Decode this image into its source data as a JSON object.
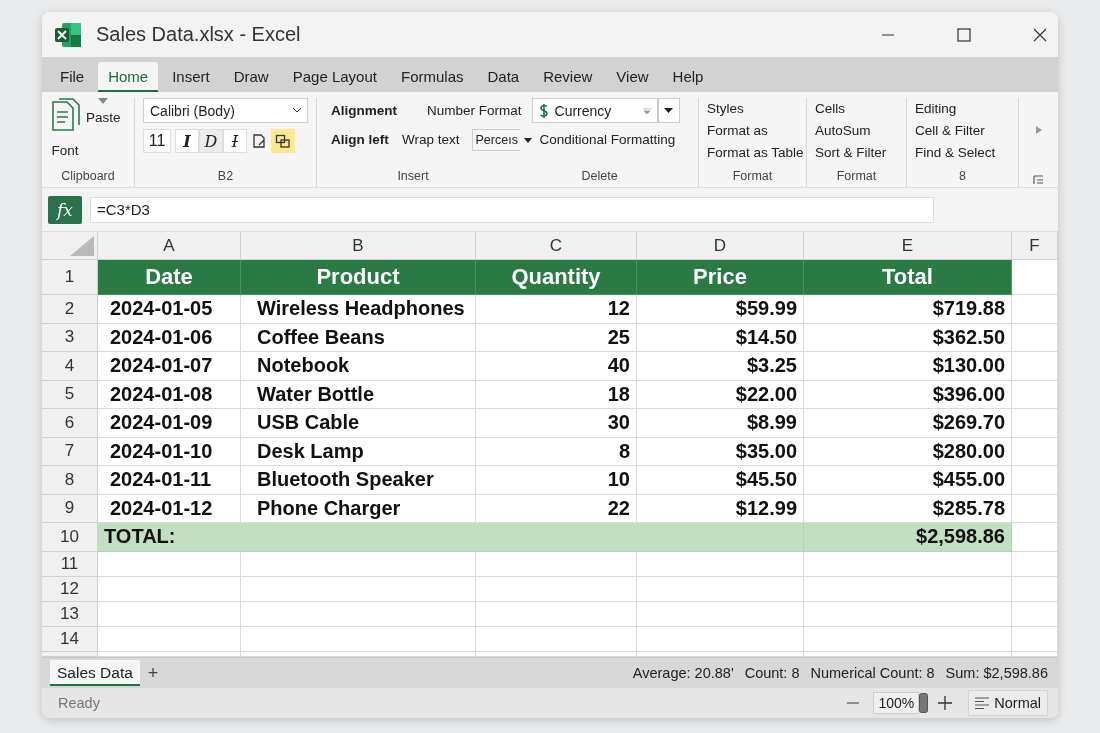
{
  "window": {
    "title": "Sales Data.xlsx - Excel"
  },
  "menu_tabs": [
    {
      "label": "File",
      "selected": false
    },
    {
      "label": "Home",
      "selected": true
    },
    {
      "label": "Insert",
      "selected": false
    },
    {
      "label": "Draw",
      "selected": false
    },
    {
      "label": "Page Layout",
      "selected": false
    },
    {
      "label": "Formulas",
      "selected": false
    },
    {
      "label": "Data",
      "selected": false
    },
    {
      "label": "Review",
      "selected": false
    },
    {
      "label": "View",
      "selected": false
    },
    {
      "label": "Help",
      "selected": false
    }
  ],
  "ribbon": {
    "clipboard": {
      "paste": "Paste",
      "font": "Font",
      "label": "Clipboard"
    },
    "font": {
      "name": "Calibri (Body)",
      "size": "11",
      "label": "B2",
      "style_buttons": [
        {
          "kind": "italic",
          "label": "I",
          "selected": false
        },
        {
          "kind": "plain",
          "label": "D",
          "selected": true
        },
        {
          "kind": "strike",
          "label": "I",
          "selected": false
        },
        {
          "kind": "clear",
          "selected": false
        },
        {
          "kind": "copy",
          "selected": true
        }
      ]
    },
    "alignment": {
      "alignment": "Alignment",
      "align_left": "Align left",
      "wrap_text": "Wrap text",
      "number_format_label": "Number Format",
      "number_format": "Currency",
      "percent_field": "Perceıs",
      "conditional_formatting": "Conditional Formatting",
      "labels": [
        "Insert",
        "Delete"
      ]
    },
    "groups": [
      {
        "items": [
          "Styles",
          "Format as",
          "Format as Table"
        ],
        "label": "Format"
      },
      {
        "items": [
          "Cells",
          "AutoSum",
          "Sort & Filter"
        ],
        "label": "Format"
      },
      {
        "items": [
          "Editing",
          "Cell & Filter",
          "Find & Select"
        ],
        "label": "8"
      }
    ]
  },
  "formula_bar": {
    "fx": "fx",
    "formula": "=C3*D3"
  },
  "sheet": {
    "columns": [
      "A",
      "B",
      "C",
      "D",
      "E",
      "F"
    ],
    "header": {
      "number": "1",
      "cells": [
        "Date",
        "Product",
        "Quantity",
        "Price",
        "Total"
      ]
    },
    "rows": [
      {
        "number": "2",
        "cells": [
          "2024-01-05",
          "Wireless Headphones",
          "12",
          "$59.99",
          "$719.88"
        ]
      },
      {
        "number": "3",
        "cells": [
          "2024-01-06",
          "Coffee Beans",
          "25",
          "$14.50",
          "$362.50"
        ]
      },
      {
        "number": "4",
        "cells": [
          "2024-01-07",
          "Notebook",
          "40",
          "$3.25",
          "$130.00"
        ]
      },
      {
        "number": "5",
        "cells": [
          "2024-01-08",
          "Water Bottle",
          "18",
          "$22.00",
          "$396.00"
        ]
      },
      {
        "number": "6",
        "cells": [
          "2024-01-09",
          "USB Cable",
          "30",
          "$8.99",
          "$269.70"
        ]
      },
      {
        "number": "7",
        "cells": [
          "2024-01-10",
          "Desk Lamp",
          "8",
          "$35.00",
          "$280.00"
        ]
      },
      {
        "number": "8",
        "cells": [
          "2024-01-11",
          "Bluetooth Speaker",
          "10",
          "$45.50",
          "$455.00"
        ]
      },
      {
        "number": "9",
        "cells": [
          "2024-01-12",
          "Phone Charger",
          "22",
          "$12.99",
          "$285.78"
        ]
      }
    ],
    "total": {
      "number": "10",
      "label": "TOTAL:",
      "value": "$2,598.86"
    },
    "empty_rows": [
      "11",
      "12",
      "13",
      "14"
    ]
  },
  "status": {
    "sheet_tabs": [
      {
        "label": "Sales Data",
        "selected": true
      }
    ],
    "add_sheet": "+",
    "stats": [
      "Average: 20.88'",
      "Count: 8",
      "Numerical Count: 8",
      "Sum: $2,598.86"
    ],
    "mode": "Ready",
    "zoom": "100%",
    "view": "Normal"
  }
}
